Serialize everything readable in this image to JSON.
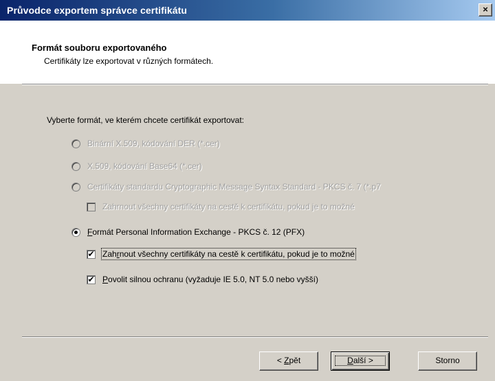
{
  "window": {
    "title": "Průvodce exportem správce certifikátu",
    "close_glyph": "×"
  },
  "header": {
    "title": "Formát souboru exportovaného",
    "subtitle": "Certifikáty lze exportovat v různých formátech."
  },
  "prompt": "Vyberte formát, ve kterém chcete certifikát exportovat:",
  "options": {
    "der": {
      "label": "Binární X.509, kódování DER (*.cer)",
      "enabled": false,
      "selected": false
    },
    "base64": {
      "label": "X.509, kódování Base64 (*.cer)",
      "enabled": false,
      "selected": false
    },
    "pkcs7": {
      "label": "Certifikáty standardu Cryptographic Message Syntax Standard - PKCS č. 7 (*.p7",
      "enabled": false,
      "selected": false
    },
    "pkcs7_include_chain": {
      "label": "Zahrnout všechny certifikáty na cestě k certifikátu, pokud je to možné",
      "enabled": false,
      "checked": false
    },
    "pfx": {
      "label_accel": "F",
      "label_rest": "ormát Personal Information Exchange - PKCS č. 12 (PFX)",
      "enabled": true,
      "selected": true
    },
    "pfx_include_chain": {
      "label_pre": "Zah",
      "label_accel": "r",
      "label_rest": "nout všechny certifikáty na cestě k certifikátu, pokud je to možné",
      "enabled": true,
      "checked": true
    },
    "pfx_strong_protection": {
      "label_accel": "P",
      "label_rest": "ovolit silnou ochranu (vyžaduje IE 5.0, NT 5.0 nebo vyšší)",
      "enabled": true,
      "checked": true
    }
  },
  "buttons": {
    "back": {
      "prefix": "< ",
      "accel": "Z",
      "rest": "pět"
    },
    "next": {
      "accel": "D",
      "rest": "alší >"
    },
    "cancel": {
      "label": "Storno"
    }
  },
  "colors": {
    "title_bar_start": "#0a246a",
    "title_bar_end": "#a6caf0",
    "dialog_face": "#d4d0c8",
    "disabled_text": "#a0a0a0"
  }
}
